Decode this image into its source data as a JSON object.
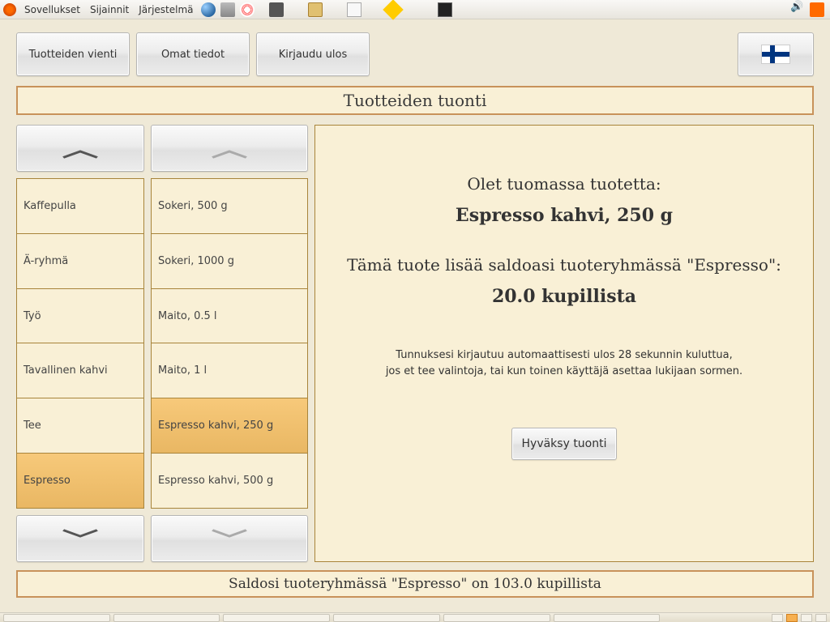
{
  "menubar": {
    "apps": "Sovellukset",
    "places": "Sijainnit",
    "system": "Järjestelmä"
  },
  "toolbar": {
    "export": "Tuotteiden vienti",
    "profile": "Omat tiedot",
    "logout": "Kirjaudu ulos"
  },
  "banner": {
    "title": "Tuotteiden tuonti"
  },
  "categories": {
    "items": [
      {
        "label": "Kaffepulla"
      },
      {
        "label": "Ä-ryhmä"
      },
      {
        "label": "Työ"
      },
      {
        "label": "Tavallinen kahvi"
      },
      {
        "label": "Tee"
      },
      {
        "label": "Espresso"
      }
    ]
  },
  "products": {
    "items": [
      {
        "label": "Sokeri, 500 g"
      },
      {
        "label": "Sokeri, 1000 g"
      },
      {
        "label": "Maito, 0.5 l"
      },
      {
        "label": "Maito, 1 l"
      },
      {
        "label": "Espresso kahvi, 250 g"
      },
      {
        "label": "Espresso kahvi, 500 g"
      }
    ]
  },
  "detail": {
    "line1": "Olet tuomassa tuotetta:",
    "line2": "Espresso kahvi, 250 g",
    "line3": "Tämä tuote lisää saldoasi tuoteryhmässä \"Espresso\":",
    "line4": "20.0 kupillista",
    "note1": "Tunnuksesi kirjautuu automaattisesti ulos 28 sekunnin kuluttua,",
    "note2": "jos et tee valintoja, tai kun toinen käyttäjä asettaa lukijaan sormen.",
    "accept": "Hyväksy tuonti"
  },
  "status": {
    "text": "Saldosi tuoteryhmässä \"Espresso\" on 103.0 kupillista"
  }
}
